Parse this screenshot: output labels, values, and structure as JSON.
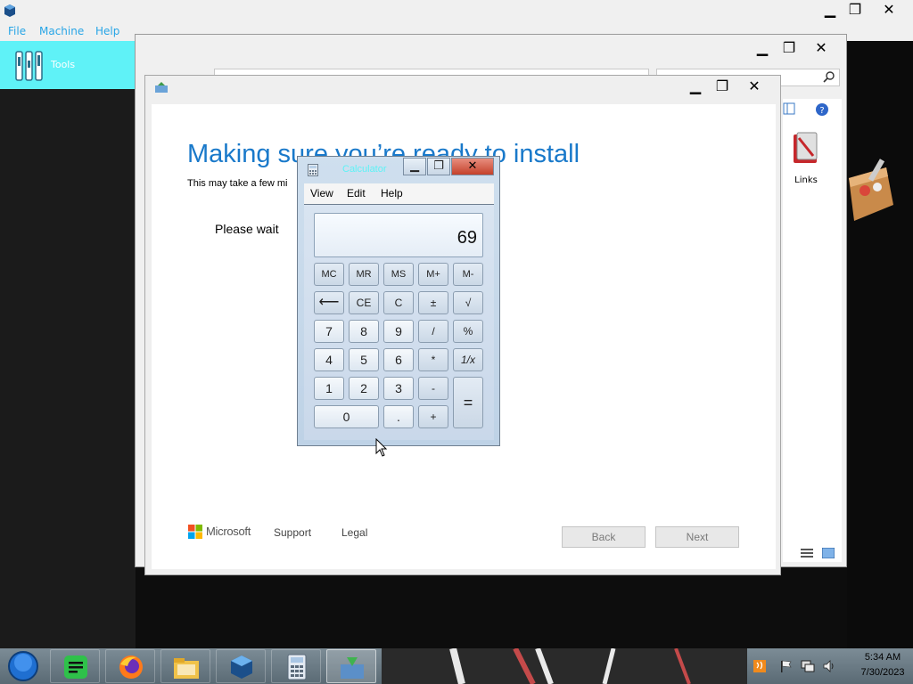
{
  "virtualbox": {
    "menu": [
      "File",
      "Machine",
      "Help"
    ],
    "tools_label": "Tools"
  },
  "explorer": {
    "links_label": "Links"
  },
  "setup": {
    "title": "Making sure you’re ready to install",
    "subtitle": "This may take a few mi",
    "status": "Please wait",
    "brand": "Microsoft",
    "support_link": "Support",
    "legal_link": "Legal",
    "back_label": "Back",
    "next_label": "Next"
  },
  "calculator": {
    "title": "Calculator",
    "menu": [
      "View",
      "Edit",
      "Help"
    ],
    "display_value": "69",
    "keys": {
      "mc": "MC",
      "mr": "MR",
      "ms": "MS",
      "mplus": "M+",
      "mminus": "M-",
      "back": "⟵",
      "ce": "CE",
      "c": "C",
      "plusminus": "±",
      "sqrt": "√",
      "k7": "7",
      "k8": "8",
      "k9": "9",
      "div": "/",
      "pct": "%",
      "k4": "4",
      "k5": "5",
      "k6": "6",
      "mul": "*",
      "recip": "1/x",
      "k1": "1",
      "k2": "2",
      "k3": "3",
      "sub": "-",
      "eq": "=",
      "k0": "0",
      "dot": ".",
      "add": "+"
    }
  },
  "taskbar": {
    "time": "5:34 AM",
    "date": "7/30/2023"
  },
  "colors": {
    "accent_blue": "#1979ca",
    "menu_cyan": "#27a5e6",
    "tools_bg": "#5ff2f7",
    "close_red": "#c4412b"
  },
  "icons": [
    "virtualbox-logo-icon",
    "tools-icon",
    "search-icon",
    "help-icon",
    "links-icon",
    "setup-icon",
    "calculator-icon",
    "microsoft-logo-icon",
    "start-orb-icon",
    "spotify-icon",
    "firefox-icon",
    "file-explorer-icon",
    "virtualbox-icon",
    "calculator-taskbar-icon",
    "setup-taskbar-icon",
    "flag-icon",
    "network-icon",
    "volume-icon",
    "mouse-cursor-icon"
  ]
}
